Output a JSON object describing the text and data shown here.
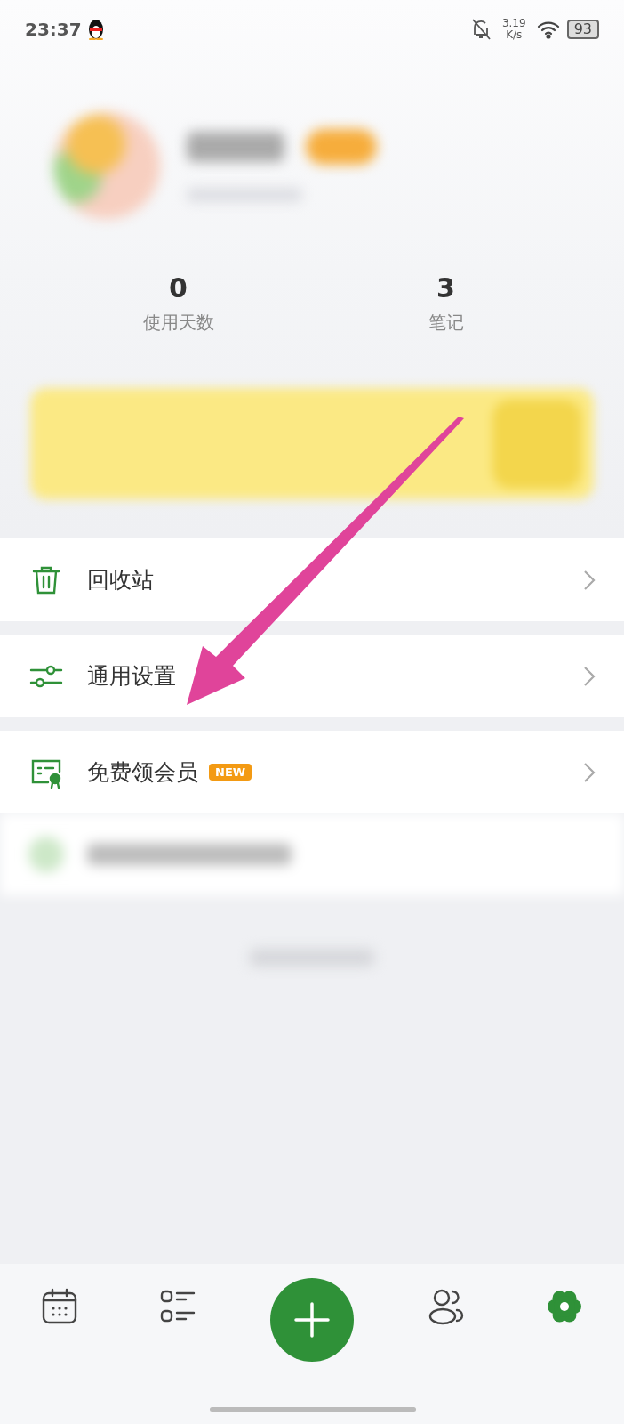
{
  "status_bar": {
    "time": "23:37",
    "speed_value": "3.19",
    "speed_unit": "K/s",
    "battery": "93"
  },
  "stats": [
    {
      "value": "0",
      "label": "使用天数"
    },
    {
      "value": "3",
      "label": "笔记"
    }
  ],
  "menu": [
    {
      "kind": "trash",
      "label": "回收站"
    },
    {
      "kind": "sliders",
      "label": "通用设置"
    },
    {
      "kind": "vip",
      "label": "免费领会员",
      "badge": "NEW"
    }
  ],
  "annotation": {
    "kind": "arrow"
  },
  "nav": [
    {
      "kind": "calendar",
      "selected": false
    },
    {
      "kind": "list",
      "selected": false
    },
    {
      "kind": "add",
      "selected": false
    },
    {
      "kind": "people",
      "selected": false
    },
    {
      "kind": "settings",
      "selected": true
    }
  ]
}
